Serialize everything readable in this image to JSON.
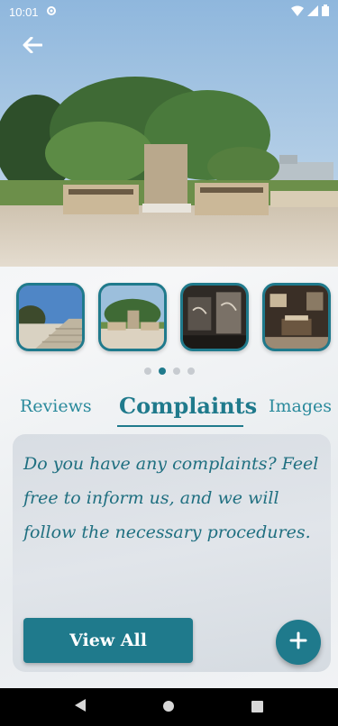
{
  "status_bar": {
    "time": "10:01",
    "icons": [
      "settings-icon",
      "wifi-icon",
      "signal-icon",
      "battery-icon"
    ]
  },
  "hero": {
    "back_icon": "arrow-left-icon",
    "plaque_left": "From Palestine... to Mahmoud Darwish",
    "plaque_right": "من فلسطين.. إلى محمود درويش"
  },
  "gallery": {
    "thumbnails": [
      {
        "icon": "stairs-photo"
      },
      {
        "icon": "memorial-photo"
      },
      {
        "icon": "exhibit-photo"
      },
      {
        "icon": "room-photo"
      }
    ],
    "dots": [
      false,
      true,
      false,
      false
    ]
  },
  "tabs": {
    "items": [
      "Reviews",
      "Complaints",
      "Images"
    ],
    "active": "Complaints"
  },
  "complaints": {
    "message": "Do you have any complaints? Feel free to inform us, and we will follow the necessary procedures.",
    "view_all_label": "View All",
    "add_icon": "plus-icon"
  },
  "colors": {
    "accent": "#1f7a8c",
    "tab_text": "#2a8a9c",
    "card_bg": "#dde2e7"
  },
  "nav": {
    "icons": [
      "back-triangle-icon",
      "home-circle-icon",
      "recents-square-icon"
    ]
  }
}
